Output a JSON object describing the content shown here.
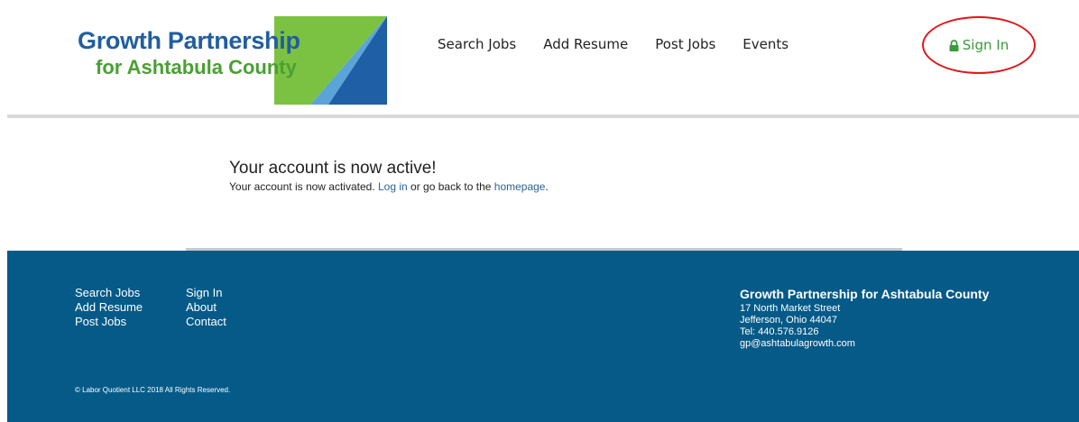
{
  "brand": {
    "line1": "Growth Partnership",
    "line2": "for Ashtabula County",
    "colors": {
      "blue": "#215e9e",
      "green": "#4aa034"
    }
  },
  "nav": {
    "items": [
      "Search Jobs",
      "Add Resume",
      "Post Jobs",
      "Events"
    ],
    "sign_in": "Sign In",
    "sign_in_icon": "lock-icon"
  },
  "message": {
    "title": "Your account is now active!",
    "before_login": "Your account is now activated. ",
    "login_link": "Log in",
    "middle": " or go back to the ",
    "home_link": "homepage",
    "after": "."
  },
  "footer": {
    "col1": [
      "Search Jobs",
      "Add Resume",
      "Post Jobs"
    ],
    "col2": [
      "Sign In",
      "About",
      "Contact"
    ],
    "org": "Growth Partnership for Ashtabula County",
    "address1": "17 North Market Street",
    "address2": "Jefferson, Ohio 44047",
    "tel": "Tel: 440.576.9126",
    "email": "gp@ashtabulagrowth.com",
    "copyright": "© Labor Quotient LLC 2018 All Rights Reserved.",
    "background": "#055a88"
  },
  "colors": {
    "sign_in": "#3a9b3a",
    "highlight_circle": "#e0161b",
    "link": "#2a6496"
  }
}
